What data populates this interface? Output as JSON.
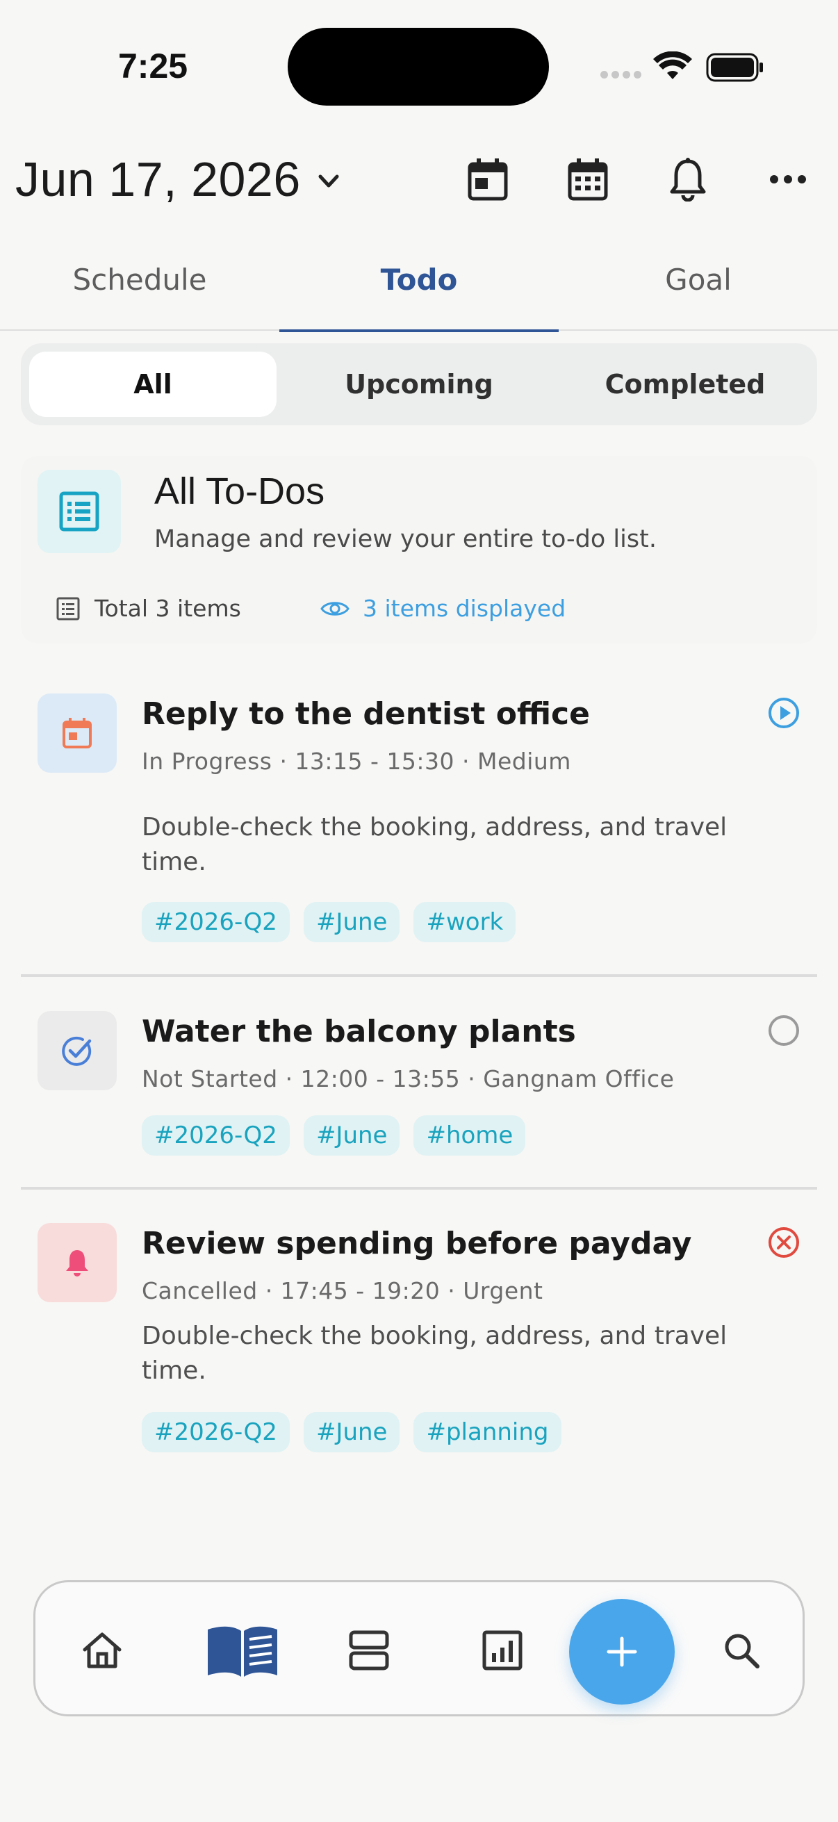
{
  "status_bar": {
    "time": "7:25"
  },
  "header": {
    "date": "Jun 17, 2026"
  },
  "tabs": [
    {
      "label": "Schedule"
    },
    {
      "label": "Todo"
    },
    {
      "label": "Goal"
    }
  ],
  "filters": [
    {
      "label": "All"
    },
    {
      "label": "Upcoming"
    },
    {
      "label": "Completed"
    }
  ],
  "summary": {
    "title": "All To-Dos",
    "subtitle": "Manage and review your entire to-do list.",
    "total": "Total 3 items",
    "displayed": "3 items displayed"
  },
  "todos": [
    {
      "title": "Reply to the dentist office",
      "meta": "In Progress · 13:15 - 15:30 · Medium",
      "description": "Double-check the booking, address, and travel time.",
      "tags": [
        "#2026-Q2",
        "#June",
        "#work"
      ],
      "icon": "calendar-icon",
      "status": "in-progress",
      "status_color": "#3d9fe0"
    },
    {
      "title": "Water the balcony plants",
      "meta": "Not Started · 12:00 - 13:55 · Gangnam Office",
      "description": "",
      "tags": [
        "#2026-Q2",
        "#June",
        "#home"
      ],
      "icon": "check-circle-icon",
      "status": "not-started",
      "status_color": "#9a9a9a"
    },
    {
      "title": "Review spending before payday",
      "meta": "Cancelled · 17:45 - 19:20 · Urgent",
      "description": "Double-check the booking, address, and travel time.",
      "tags": [
        "#2026-Q2",
        "#June",
        "#planning"
      ],
      "icon": "bell-icon",
      "status": "cancelled",
      "status_color": "#e04a3f"
    }
  ],
  "colors": {
    "accent": "#2f5596",
    "fab": "#4aa6ea",
    "tag_bg": "#e0f2f4",
    "tag_text": "#1aa3be"
  }
}
